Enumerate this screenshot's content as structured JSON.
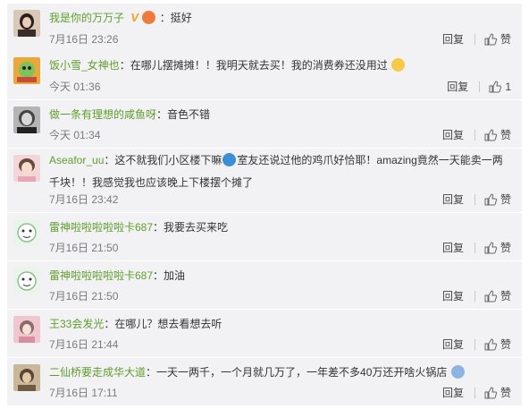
{
  "comments": [
    {
      "user": "我是你的万万子",
      "badge": "V",
      "text": "挺好",
      "time": "7月16日 23:26",
      "reply": "回复",
      "like": "赞"
    },
    {
      "user": "饭小雪_女神也",
      "text": "在哪儿摆摊摊！！我明天就去买！我的消费券还没用过",
      "time": "今天 01:36",
      "reply": "回复",
      "like": "1"
    },
    {
      "user": "做一条有理想的咸鱼呀",
      "text": "音色不错",
      "time": "今天 01:34",
      "reply": "回复",
      "like": "赞"
    },
    {
      "user": "Aseafor_uu",
      "text_part1": "这不就我们小区楼下嘛",
      "text_part2": "室友还说过他的鸡爪好恰耶！amazing竟然一天能卖一两千块！！我感觉我也应该晚上下楼摆个摊了",
      "time": "7月16日 23:42",
      "reply": "回复",
      "like": "赞"
    },
    {
      "user": "雷神啦啦啦啦啦卡687",
      "text": "我要去买来吃",
      "time": "7月16日 21:50",
      "reply": "回复",
      "like": "赞"
    },
    {
      "user": "雷神啦啦啦啦啦卡687",
      "text": "加油",
      "time": "7月16日 21:50",
      "reply": "回复",
      "like": "赞"
    },
    {
      "user": "王33会发光",
      "text": "在哪儿？想去看想去听",
      "time": "7月16日 21:44",
      "reply": "回复",
      "like": "赞"
    },
    {
      "user": "二仙桥要走成华大道",
      "text": "一天一两千，一个月就几万了，一年差不多40万还开啥火锅店",
      "time": "7月16日 17:11",
      "reply": "回复",
      "like": "赞"
    }
  ],
  "colors": {
    "username": "#5f9d2b",
    "card_bg": "#f2f2f5",
    "time": "#7a7a7a"
  },
  "icons": {
    "like": "thumbs-up-icon",
    "badge": "verified-v-icon"
  }
}
